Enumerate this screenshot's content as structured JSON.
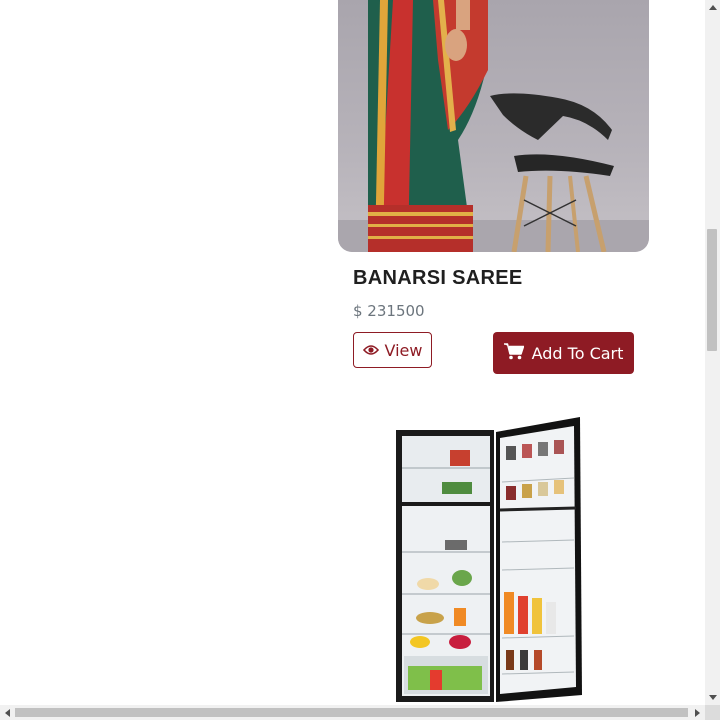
{
  "products": [
    {
      "name": "BANARSI SAREE",
      "price": "$ 231500",
      "view_label": "View",
      "cart_label": "Add To Cart",
      "image_icon": "saree-photo"
    },
    {
      "image_icon": "refrigerator-photo"
    }
  ],
  "colors": {
    "accent": "#8e1b24",
    "price_text": "#6c757d",
    "title_text": "#1f1f1f"
  },
  "icons": {
    "view": "eye-icon",
    "cart": "shopping-cart-icon"
  }
}
